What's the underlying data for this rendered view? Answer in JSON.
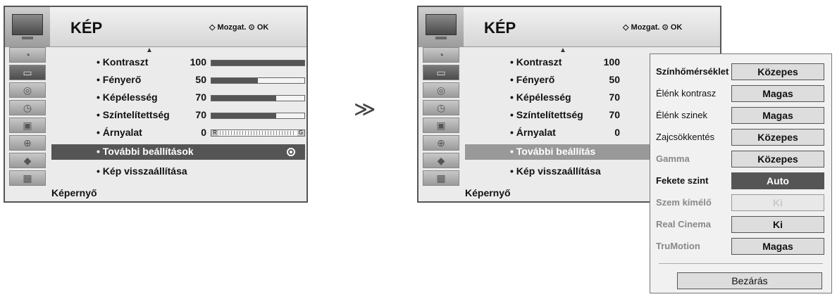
{
  "menu": {
    "title": "KÉP",
    "nav_hint": {
      "move": "Mozgat.",
      "ok": "OK"
    },
    "footer": "Képernyő",
    "items": [
      {
        "label": "• Kontraszt",
        "value": "100",
        "level": 100
      },
      {
        "label": "• Fényerő",
        "value": "50",
        "level": 50
      },
      {
        "label": "• Képélesség",
        "value": "70",
        "level": 70
      },
      {
        "label": "• Színtelítettség",
        "value": "70",
        "level": 70
      },
      {
        "label": "• Árnyalat",
        "value": "0",
        "r": "R",
        "g": "G"
      }
    ],
    "advanced": "• További beállítások",
    "advanced_truncated": "• További beállítás",
    "reset": "• Kép visszaállítása",
    "reset_truncated": "• Kép visszaállítása"
  },
  "panel": {
    "rows": [
      {
        "label": "Színhőmérséklet",
        "value": "Közepes"
      },
      {
        "label": "Élénk kontrasz",
        "value": "Magas"
      },
      {
        "label": "Élénk szinek",
        "value": "Magas"
      },
      {
        "label": "Zajcsökkentés",
        "value": "Közepes"
      },
      {
        "label": "Gamma",
        "value": "Közepes"
      },
      {
        "label": "Fekete szint",
        "value": "Auto"
      },
      {
        "label": "Szem kímélő",
        "value": "Ki"
      },
      {
        "label": "Real Cinema",
        "value": "Ki"
      },
      {
        "label": "TruMotion",
        "value": "Magas"
      }
    ],
    "close": "Bezárás"
  },
  "separator": "≫",
  "colors": {
    "highlight": "#555555",
    "panel_bg": "#f1f1f1"
  }
}
